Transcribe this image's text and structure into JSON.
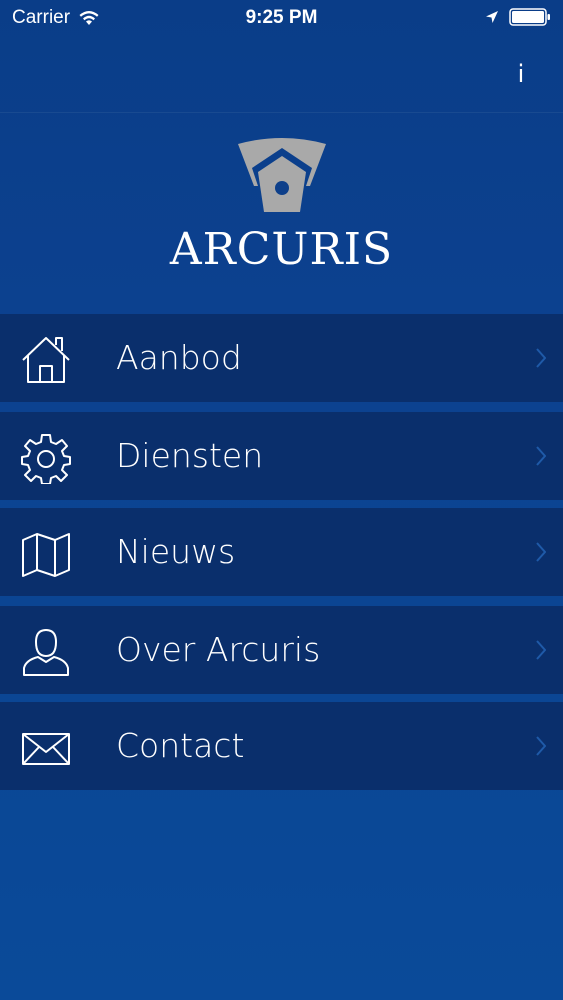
{
  "status_bar": {
    "carrier": "Carrier",
    "time": "9:25 PM",
    "wifi_icon": "wifi-icon",
    "location_icon": "location-arrow-icon",
    "battery_icon": "battery-icon"
  },
  "header": {
    "info_label": "i",
    "logo_icon": "arcuris-shield-logo",
    "brand_name": "ARCURIS"
  },
  "menu": {
    "items": [
      {
        "label": "Aanbod",
        "icon": "home-icon"
      },
      {
        "label": "Diensten",
        "icon": "gear-icon"
      },
      {
        "label": "Nieuws",
        "icon": "map-icon"
      },
      {
        "label": "Over Arcuris",
        "icon": "person-icon"
      },
      {
        "label": "Contact",
        "icon": "envelope-icon"
      }
    ]
  },
  "colors": {
    "background": "#0b4190",
    "menu_item": "#0a2f6c",
    "logo_gray": "#a9a9a9",
    "text": "#ffffff",
    "chevron": "#1f5aa8"
  }
}
